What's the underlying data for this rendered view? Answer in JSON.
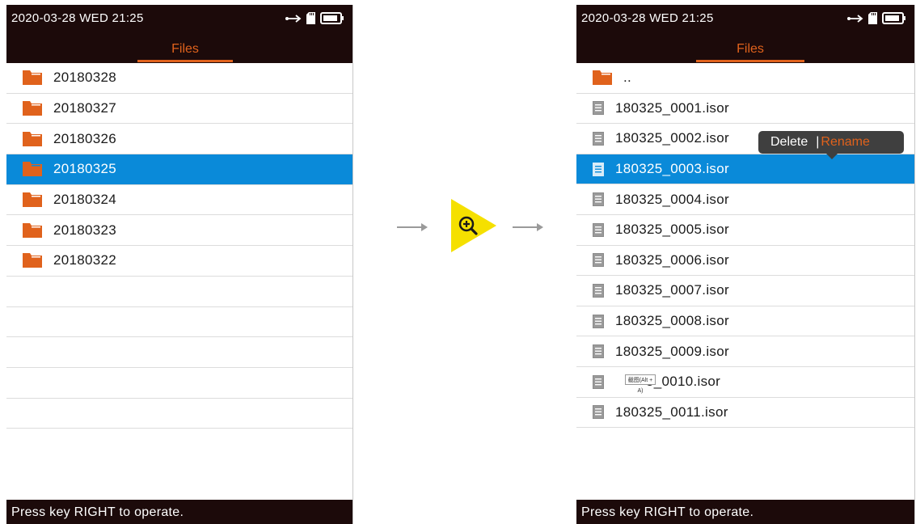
{
  "left_screen": {
    "status_time": "2020-03-28  WED  21:25",
    "tab_label": "Files",
    "folders": [
      "20180328",
      "20180327",
      "20180326",
      "20180325",
      "20180324",
      "20180323",
      "20180322"
    ],
    "selected_index": 3,
    "footer": "Press key RIGHT to operate."
  },
  "right_screen": {
    "status_time": "2020-03-28  WED  21:25",
    "tab_label": "Files",
    "parent_label": "..",
    "files": [
      "180325_0001.isor",
      "180325_0002.isor",
      "180325_0003.isor",
      "180325_0004.isor",
      "180325_0005.isor",
      "180325_0006.isor",
      "180325_0007.isor",
      "180325_0008.isor",
      "180325_0009.isor",
      "5_0010.isor",
      "180325_0011.isor"
    ],
    "selected_file_index": 2,
    "popup": {
      "delete": "Delete",
      "separator": "|",
      "rename": "Rename"
    },
    "screenshot_badge": "截图(Alt + A)",
    "footer": "Press key RIGHT to operate."
  },
  "colors": {
    "accent": "#e0621c",
    "selection": "#0a8ad9",
    "bar": "#1c0a0a",
    "magnifier": "#f5e000"
  },
  "icons": [
    "usb-icon",
    "sd-card-icon",
    "battery-icon",
    "folder-icon",
    "document-icon",
    "zoom-in-icon",
    "arrow-right-icon"
  ]
}
